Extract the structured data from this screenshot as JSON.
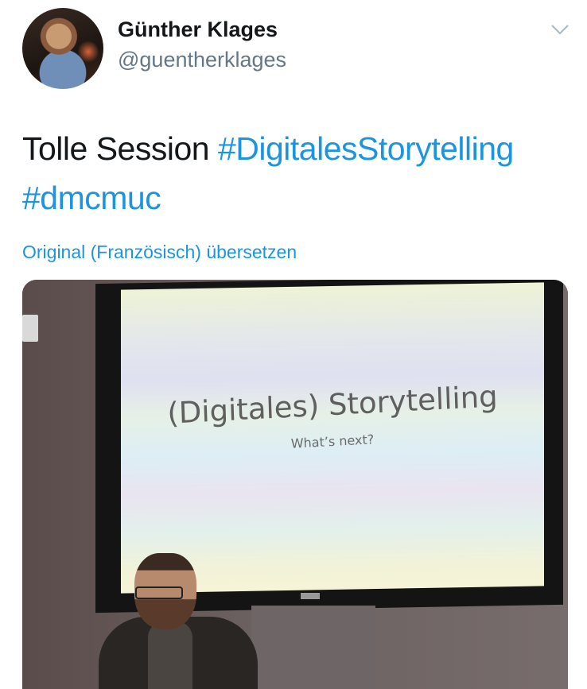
{
  "user": {
    "display_name": "Günther Klages",
    "handle": "@guentherklages"
  },
  "tweet": {
    "text_plain": "Tolle Session ",
    "hashtag_1": "#DigitalesStorytelling",
    "hashtag_2": "#dmcmuc",
    "translate_label": "Original (Französisch) übersetzen"
  },
  "media": {
    "slide_title": "(Digitales) Storytelling",
    "slide_subtitle": "What’s next?"
  },
  "icons": {
    "more": "chevron-down-icon"
  },
  "colors": {
    "link": "#1b95e0",
    "text": "#14171a",
    "secondary": "#657786"
  }
}
